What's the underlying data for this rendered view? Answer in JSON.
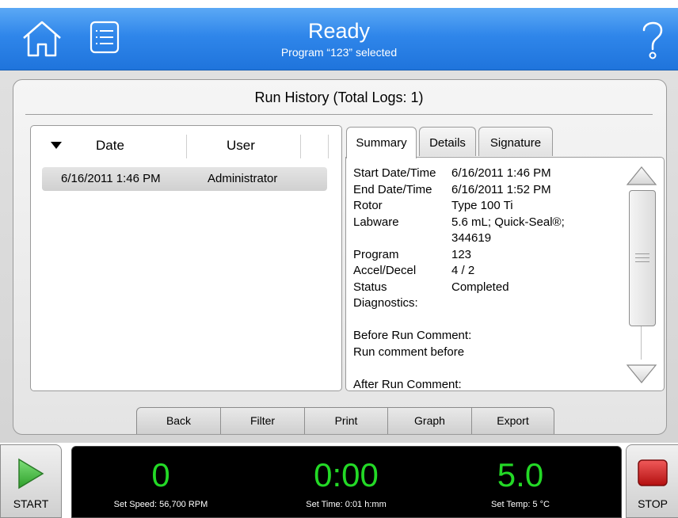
{
  "header": {
    "status_title": "Ready",
    "status_subtitle": "Program “123” selected",
    "home_icon": "home-icon",
    "menu_icon": "list-menu-icon",
    "help_icon": "question-mark-icon",
    "colors": {
      "header_blue": "#2f86ea",
      "accent_green": "#23d926",
      "stop_red": "#d01818"
    }
  },
  "page": {
    "title": "Run History (Total Logs: 1)"
  },
  "log_list": {
    "columns": [
      "Date",
      "User"
    ],
    "sort": "descending",
    "rows": [
      {
        "date": "6/16/2011 1:46 PM",
        "user": "Administrator"
      }
    ]
  },
  "tabs": {
    "items": [
      "Summary",
      "Details",
      "Signature"
    ],
    "selected": "Summary"
  },
  "summary": {
    "rows": [
      {
        "label": "Start Date/Time",
        "value": "6/16/2011 1:46 PM"
      },
      {
        "label": "End Date/Time",
        "value": "6/16/2011 1:52 PM"
      },
      {
        "label": "Rotor",
        "value": "Type 100 Ti"
      },
      {
        "label": "Labware",
        "value": "5.6 mL; Quick-Seal®;"
      },
      {
        "label": "",
        "value": "344619"
      },
      {
        "label": "Program",
        "value": "123"
      },
      {
        "label": "Accel/Decel",
        "value": "4 / 2"
      },
      {
        "label": "Status",
        "value": "Completed"
      },
      {
        "label": "Diagnostics:",
        "value": ""
      }
    ],
    "before_run_comment_label": "Before Run Comment:",
    "before_run_comment": "Run comment before",
    "after_run_comment_label": "After Run Comment:"
  },
  "actions": [
    "Back",
    "Filter",
    "Print",
    "Graph",
    "Export"
  ],
  "run_panel": {
    "start_label": "START",
    "stop_label": "STOP",
    "speed": "0",
    "set_speed": "Set Speed: 56,700 RPM",
    "time": "0:00",
    "set_time": "Set Time: 0:01 h:mm",
    "temp": "5.0",
    "set_temp": "Set Temp: 5 °C"
  }
}
